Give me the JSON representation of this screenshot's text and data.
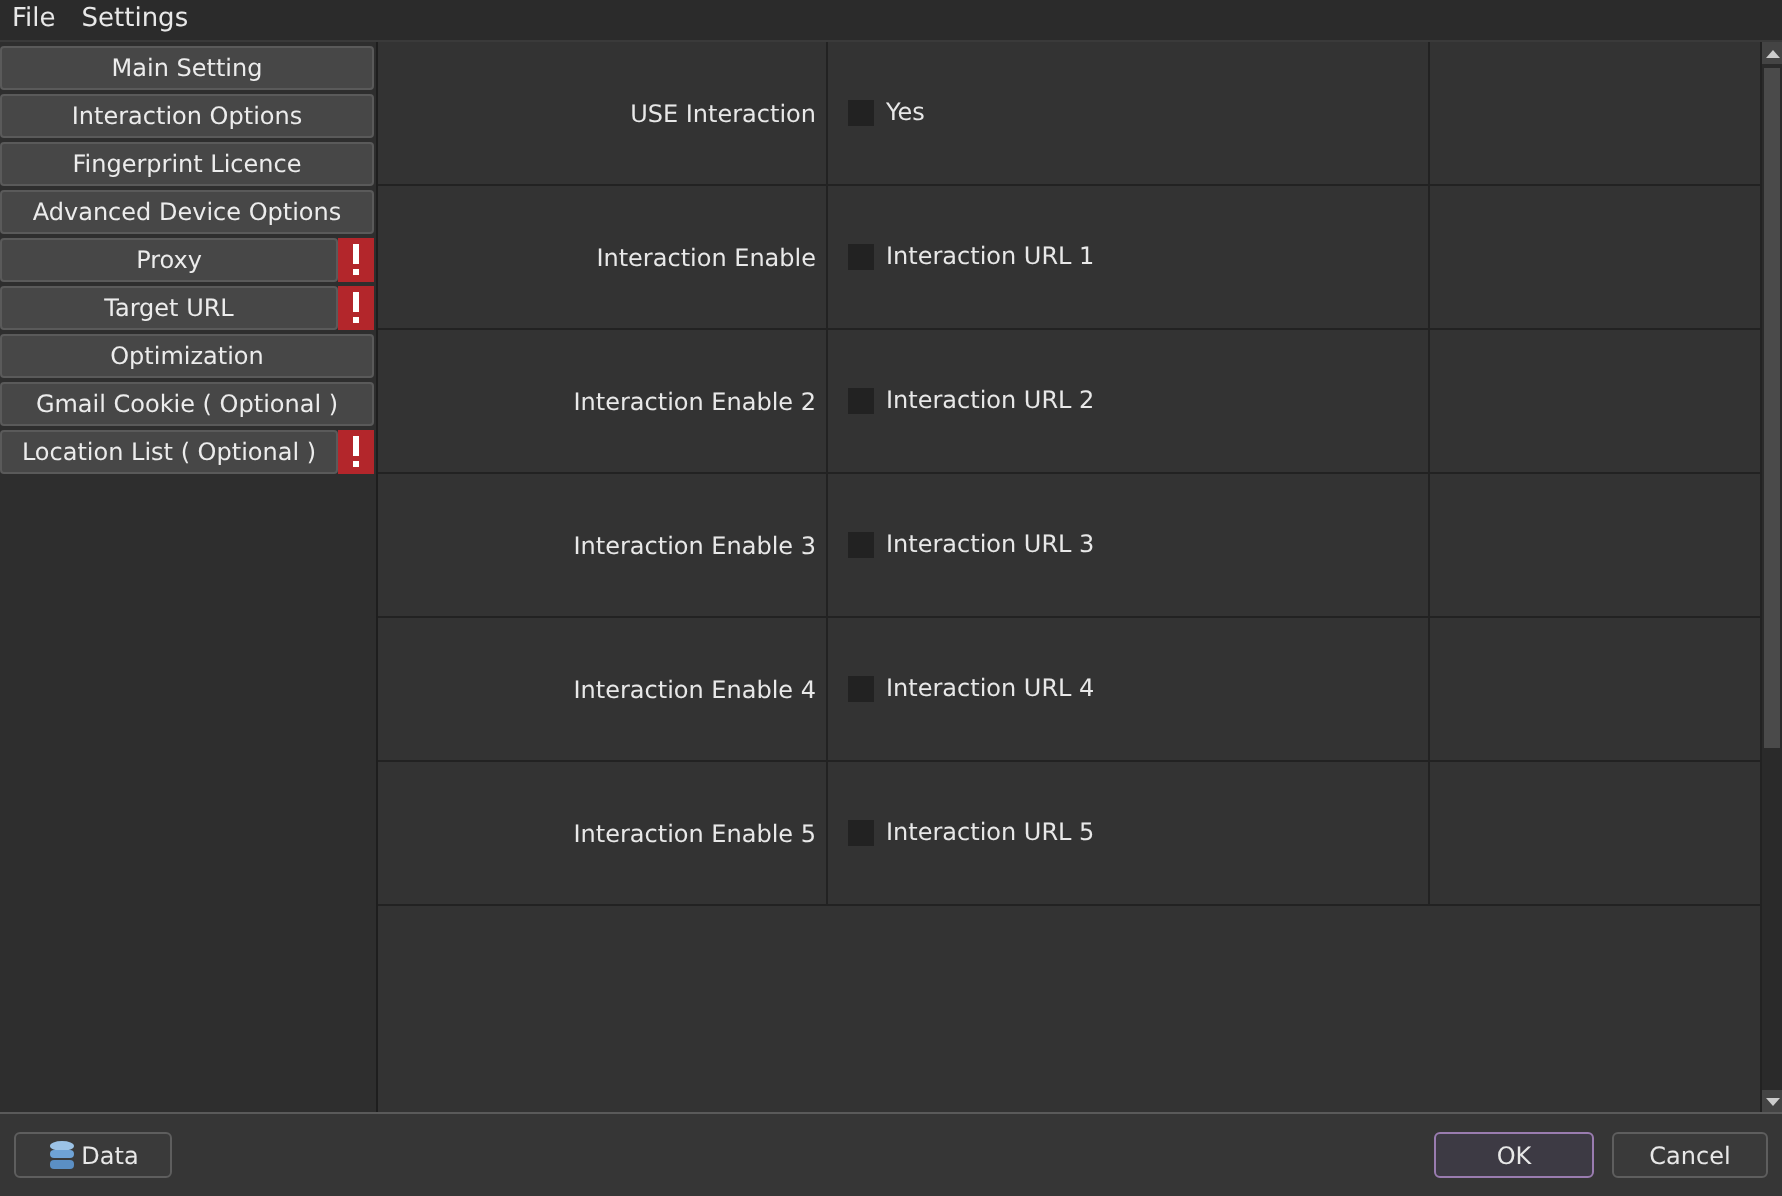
{
  "menu": [
    "File",
    "Settings"
  ],
  "sidebar": {
    "items": [
      {
        "label": "Main Setting",
        "warning": false
      },
      {
        "label": "Interaction Options",
        "warning": false
      },
      {
        "label": "Fingerprint Licence",
        "warning": false
      },
      {
        "label": "Advanced Device Options",
        "warning": false
      },
      {
        "label": "Proxy",
        "warning": true
      },
      {
        "label": "Target URL",
        "warning": true
      },
      {
        "label": "Optimization",
        "warning": false
      },
      {
        "label": "Gmail Cookie ( Optional )",
        "warning": false
      },
      {
        "label": "Location List ( Optional )",
        "warning": true
      }
    ]
  },
  "rows": [
    {
      "label": "USE Interaction",
      "option": "Yes",
      "checked": false
    },
    {
      "label": "Interaction Enable",
      "option": "Interaction URL 1",
      "checked": false
    },
    {
      "label": "Interaction Enable 2",
      "option": "Interaction URL 2",
      "checked": false
    },
    {
      "label": "Interaction Enable 3",
      "option": "Interaction URL 3",
      "checked": false
    },
    {
      "label": "Interaction Enable 4",
      "option": "Interaction URL 4",
      "checked": false
    },
    {
      "label": "Interaction Enable 5",
      "option": "Interaction URL 5",
      "checked": false
    }
  ],
  "footer": {
    "data_button": "Data",
    "ok_button": "OK",
    "cancel_button": "Cancel"
  }
}
